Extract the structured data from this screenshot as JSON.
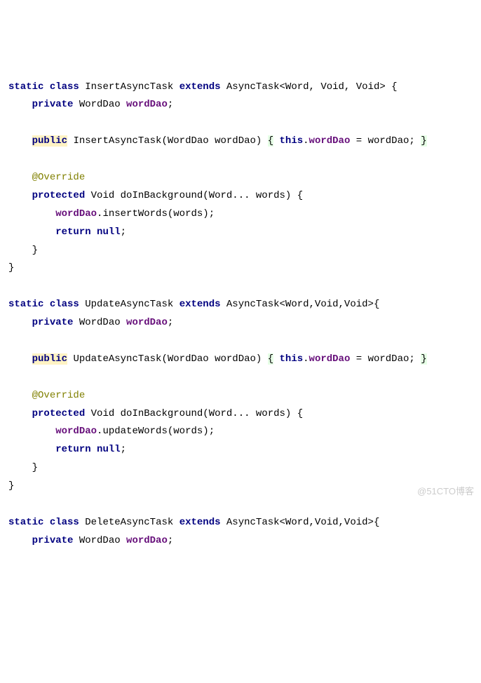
{
  "code": {
    "kw_static": "static",
    "kw_class": "class",
    "kw_extends": "extends",
    "kw_private": "private",
    "kw_public": "public",
    "kw_protected": "protected",
    "kw_return": "return",
    "kw_null": "null",
    "kw_this": "this",
    "annotation": "@Override",
    "class_insert": "InsertAsyncTask",
    "class_update": "UpdateAsyncTask",
    "class_delete": "DeleteAsyncTask",
    "async_generic_spaced": "AsyncTask<Word, Void, Void>",
    "async_generic": "AsyncTask<Word,Void,Void>",
    "type_worddao": "WordDao",
    "type_void": "Void",
    "type_word": "Word",
    "field_worddao": "wordDao",
    "param_worddao": "wordDao",
    "param_words": "words",
    "method_doInBg": "doInBackground",
    "method_insert": "insertWords",
    "method_update": "updateWords",
    "assign": " = wordDao; ",
    "dot": ".",
    "dots": "... ",
    "semi": ";",
    "lparen": "(",
    "rparen": ")",
    "lbrace": "{",
    "rbrace": "}",
    "space": " "
  },
  "watermark": "@51CTO博客"
}
